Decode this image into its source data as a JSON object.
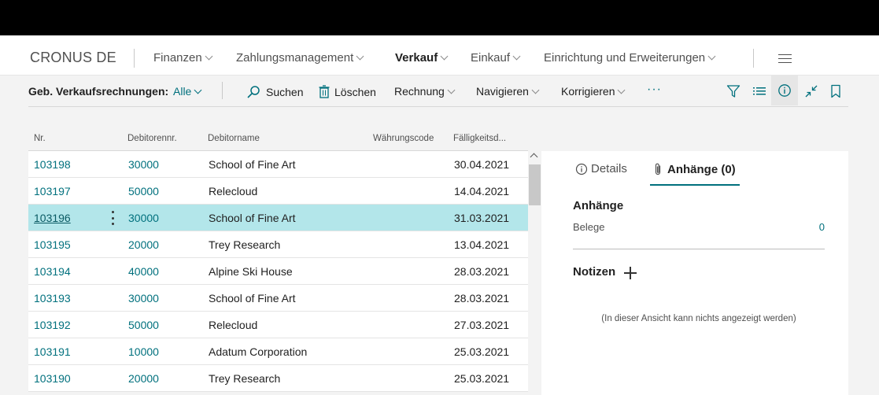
{
  "app": {
    "company": "CRONUS DE",
    "nav": [
      {
        "label": "Finanzen",
        "active": false
      },
      {
        "label": "Zahlungsmanagement",
        "active": false
      },
      {
        "label": "Verkauf",
        "active": true
      },
      {
        "label": "Einkauf",
        "active": false
      },
      {
        "label": "Einrichtung und Erweiterungen",
        "active": false
      }
    ]
  },
  "actionbar": {
    "page_title": "Geb. Verkaufsrechnungen:",
    "filter": "Alle",
    "search": "Suchen",
    "delete": "Löschen",
    "invoice": "Rechnung",
    "navigate": "Navigieren",
    "correct": "Korrigieren",
    "more": "···"
  },
  "list": {
    "columns": [
      "Nr.",
      "Debitorennr.",
      "Debitorname",
      "Währungscode",
      "Fälligkeitsd..."
    ],
    "selected_index": 2,
    "rows": [
      {
        "nr": "103198",
        "debitor_nr": "30000",
        "name": "School of Fine Art",
        "currency": "",
        "due": "30.04.2021"
      },
      {
        "nr": "103197",
        "debitor_nr": "50000",
        "name": "Relecloud",
        "currency": "",
        "due": "14.04.2021"
      },
      {
        "nr": "103196",
        "debitor_nr": "30000",
        "name": "School of Fine Art",
        "currency": "",
        "due": "31.03.2021"
      },
      {
        "nr": "103195",
        "debitor_nr": "20000",
        "name": "Trey Research",
        "currency": "",
        "due": "13.04.2021"
      },
      {
        "nr": "103194",
        "debitor_nr": "40000",
        "name": "Alpine Ski House",
        "currency": "",
        "due": "28.03.2021"
      },
      {
        "nr": "103193",
        "debitor_nr": "30000",
        "name": "School of Fine Art",
        "currency": "",
        "due": "28.03.2021"
      },
      {
        "nr": "103192",
        "debitor_nr": "50000",
        "name": "Relecloud",
        "currency": "",
        "due": "27.03.2021"
      },
      {
        "nr": "103191",
        "debitor_nr": "10000",
        "name": "Adatum Corporation",
        "currency": "",
        "due": "25.03.2021"
      },
      {
        "nr": "103190",
        "debitor_nr": "20000",
        "name": "Trey Research",
        "currency": "",
        "due": "25.03.2021"
      }
    ]
  },
  "factbox": {
    "tab_details": "Details",
    "tab_attachments": "Anhänge (0)",
    "attachments_heading": "Anhänge",
    "documents_label": "Belege",
    "documents_value": "0",
    "notes_heading": "Notizen",
    "empty_text": "(In dieser Ansicht kann nichts angezeigt werden)"
  },
  "colors": {
    "accent": "#00707d",
    "selected_row": "#b3e6ea"
  }
}
